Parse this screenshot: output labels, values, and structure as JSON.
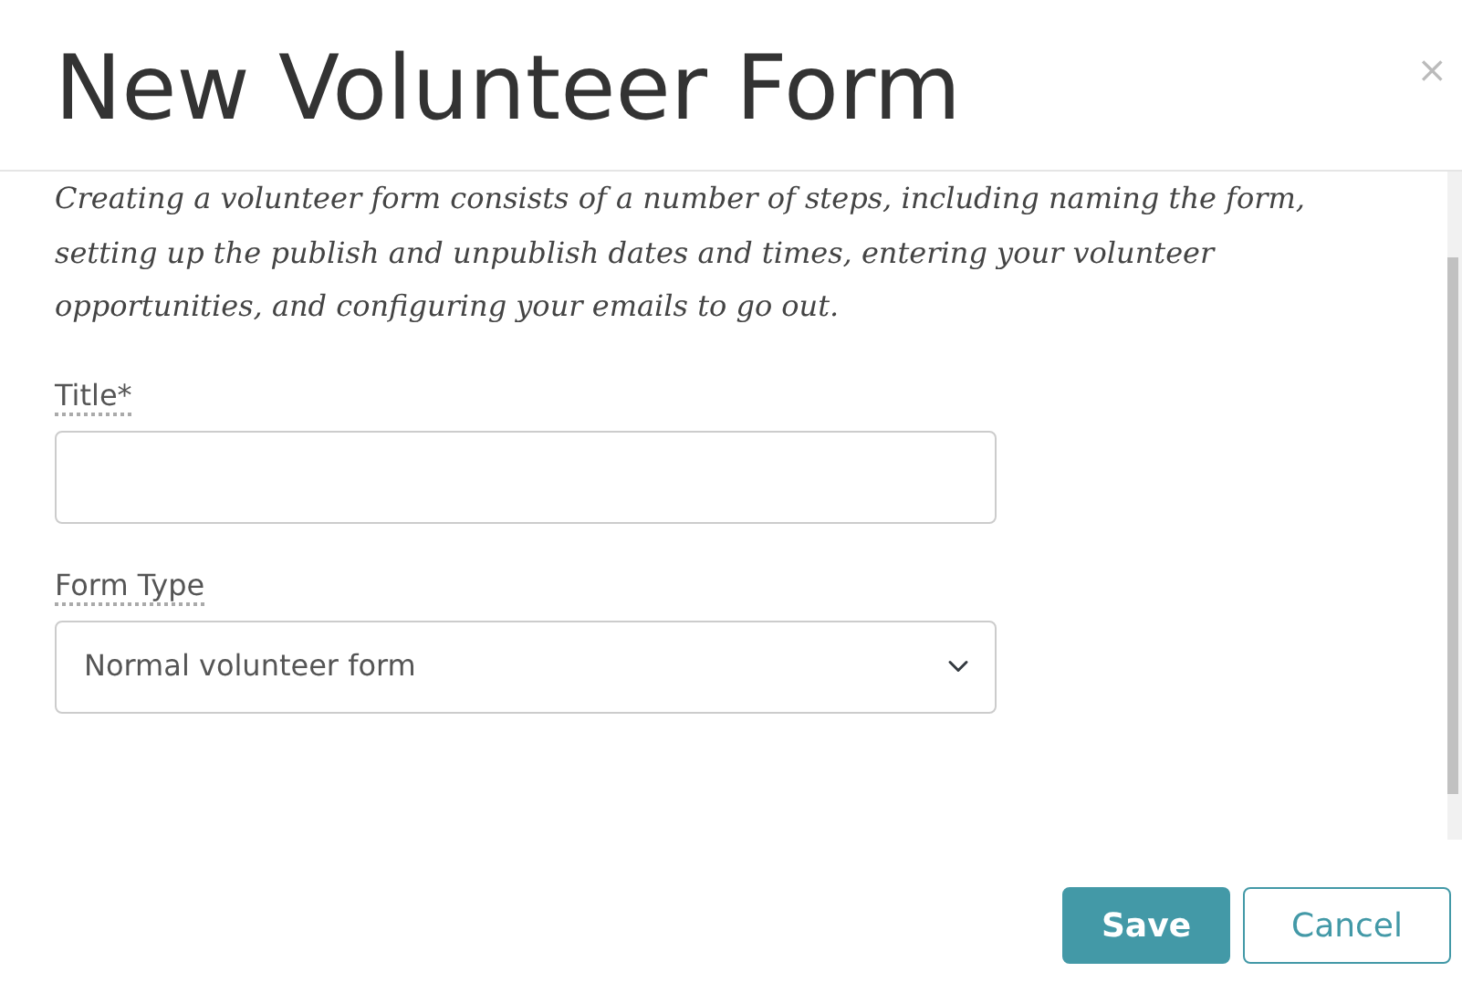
{
  "dialog": {
    "title": "New Volunteer Form",
    "close": "×",
    "description": "Creating a volunteer form consists of a number of steps, including naming the form, setting up the publish and unpublish dates and times, entering your volunteer opportunities, and configuring your emails to go out."
  },
  "fields": [
    {
      "kind": "text",
      "label": "Title*"
    },
    {
      "kind": "select",
      "label": "Form Type",
      "value": "Normal volunteer form"
    }
  ],
  "buttons": [
    {
      "kind": "primary",
      "label": "Save"
    },
    {
      "kind": "outline",
      "label": "Cancel"
    }
  ]
}
